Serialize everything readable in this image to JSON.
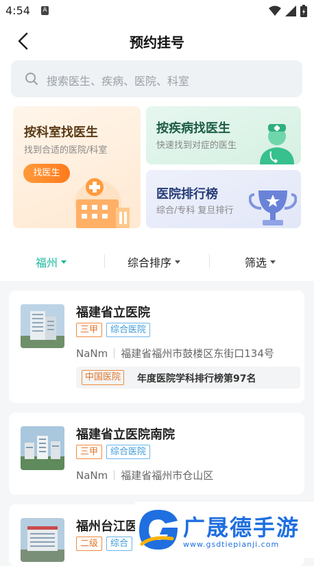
{
  "status_bar": {
    "time": "4:54",
    "sim_label": "A"
  },
  "header": {
    "title": "预约挂号"
  },
  "search": {
    "placeholder": "搜索医生、疾病、医院、科室"
  },
  "quick_entries": {
    "by_department": {
      "title": "按科室找医生",
      "subtitle": "找到合适的医院/科室",
      "button": "找医生"
    },
    "by_disease": {
      "title": "按疾病找医生",
      "subtitle": "快速找到对症的医生"
    },
    "hospital_ranking": {
      "title": "医院排行榜",
      "subtitle": "综合/专科 复旦排行"
    }
  },
  "filters": [
    {
      "label": "福州",
      "active": true
    },
    {
      "label": "综合排序",
      "active": false
    },
    {
      "label": "筛选",
      "active": false
    }
  ],
  "hospitals": [
    {
      "name": "福建省立医院",
      "level": "三甲",
      "type": "综合医院",
      "distance": "NaNm",
      "address": "福建省福州市鼓楼区东街口134号",
      "rank_tag": "中国医院",
      "rank_text": "年度医院学科排行榜第97名"
    },
    {
      "name": "福建省立医院南院",
      "level": "三甲",
      "type": "综合医院",
      "distance": "NaNm",
      "address": "福建省福州市仓山区"
    },
    {
      "name": "福州台江医",
      "level": "二级",
      "type": "综合"
    }
  ],
  "watermark": {
    "title": "广晟德手游",
    "url": "www.gsdtiepianji.com"
  },
  "colors": {
    "accent": "#18b89a",
    "orange": "#ff7a1c",
    "level_tag": "#e0762a",
    "type_tag": "#3b9ad8"
  }
}
